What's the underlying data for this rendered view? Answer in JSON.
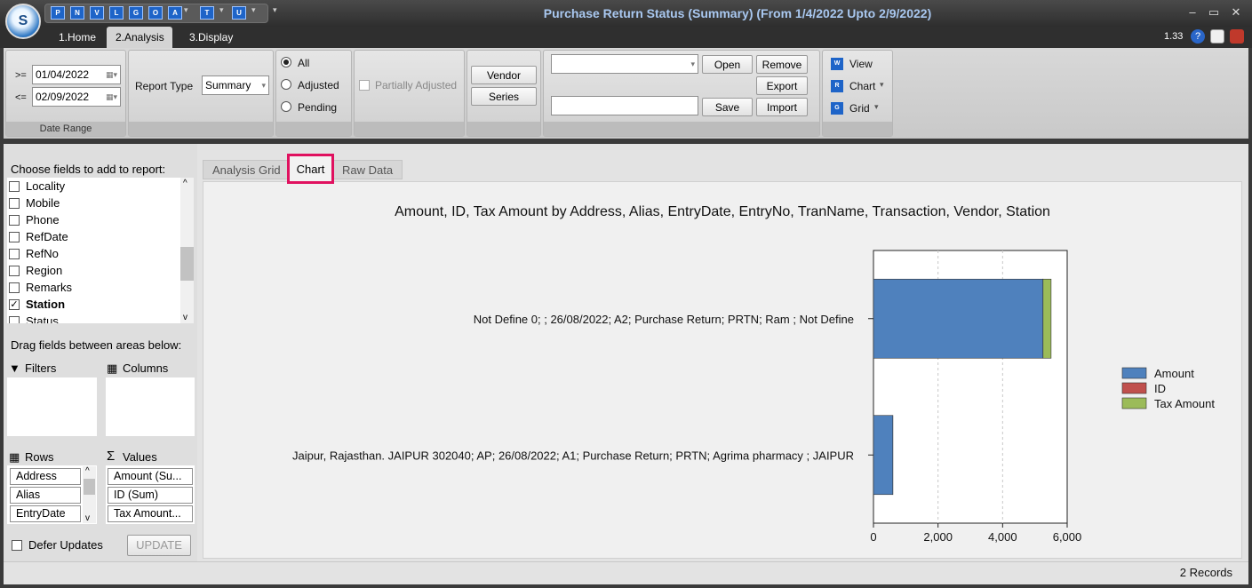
{
  "app": {
    "title": "Purchase Return Status (Summary)  (From 1/4/2022 Upto 2/9/2022)",
    "version": "1.33",
    "logo_letter": "S",
    "quick_access": [
      "P",
      "N",
      "V",
      "L",
      "G",
      "O",
      "A",
      "T",
      "U"
    ]
  },
  "ribbon_tabs": [
    "1.Home",
    "2.Analysis",
    "3.Display"
  ],
  "ribbon": {
    "date_range": {
      "from_op": ">=",
      "from_value": "01/04/2022",
      "to_op": "<=",
      "to_value": "02/09/2022",
      "caption": "Date Range"
    },
    "report_type": {
      "label": "Report Type",
      "value": "Summary"
    },
    "status_options": [
      {
        "label": "All",
        "selected": true
      },
      {
        "label": "Adjusted",
        "selected": false
      },
      {
        "label": "Pending",
        "selected": false
      }
    ],
    "partially_adjusted": {
      "label": "Partially Adjusted",
      "checked": false
    },
    "vendor_button": "Vendor",
    "series_button": "Series",
    "layout": {
      "combo_value": "",
      "name_value": "",
      "open": "Open",
      "remove": "Remove",
      "export": "Export",
      "save": "Save",
      "import": "Import"
    },
    "view": {
      "view": "View",
      "chart": "Chart",
      "grid": "Grid"
    }
  },
  "field_panel": {
    "heading": "Choose fields to add to report:",
    "fields": [
      {
        "label": "Locality",
        "checked": false
      },
      {
        "label": "Mobile",
        "checked": false
      },
      {
        "label": "Phone",
        "checked": false
      },
      {
        "label": "RefDate",
        "checked": false
      },
      {
        "label": "RefNo",
        "checked": false
      },
      {
        "label": "Region",
        "checked": false
      },
      {
        "label": "Remarks",
        "checked": false
      },
      {
        "label": "Station",
        "checked": true
      },
      {
        "label": "Status",
        "checked": false
      }
    ],
    "drag_heading": "Drag fields between areas below:",
    "filters_label": "Filters",
    "columns_label": "Columns",
    "rows_label": "Rows",
    "values_label": "Values",
    "rows": [
      "Address",
      "Alias",
      "EntryDate"
    ],
    "values": [
      "Amount (Su...",
      "ID (Sum)",
      "Tax Amount..."
    ],
    "defer_updates": "Defer Updates",
    "update_button": "UPDATE"
  },
  "content_tabs": [
    "Analysis Grid",
    "Chart",
    "Raw Data"
  ],
  "chart_data": {
    "type": "bar",
    "orientation": "horizontal",
    "stacked": true,
    "title": "Amount, ID, Tax Amount by Address, Alias, EntryDate, EntryNo, TranName, Transaction, Vendor, Station",
    "categories": [
      "Not Define 0; ; 26/08/2022; A2; Purchase Return; PRTN; Ram ; Not Define",
      "Jaipur, Rajasthan.   JAIPUR              302040; AP; 26/08/2022; A1; Purchase Return; PRTN; Agrima pharmacy ; JAIPUR"
    ],
    "series": [
      {
        "name": "Amount",
        "color": "#4f81bd",
        "values": [
          5250,
          600
        ]
      },
      {
        "name": "ID",
        "color": "#c0504d",
        "values": [
          2,
          1
        ]
      },
      {
        "name": "Tax Amount",
        "color": "#9bbb59",
        "values": [
          250,
          0
        ]
      }
    ],
    "xticks": [
      "0",
      "2,000",
      "4,000",
      "6,000"
    ],
    "xlim": [
      0,
      6000
    ],
    "grid": true,
    "legend": "right"
  },
  "status": {
    "records": "2 Records"
  }
}
